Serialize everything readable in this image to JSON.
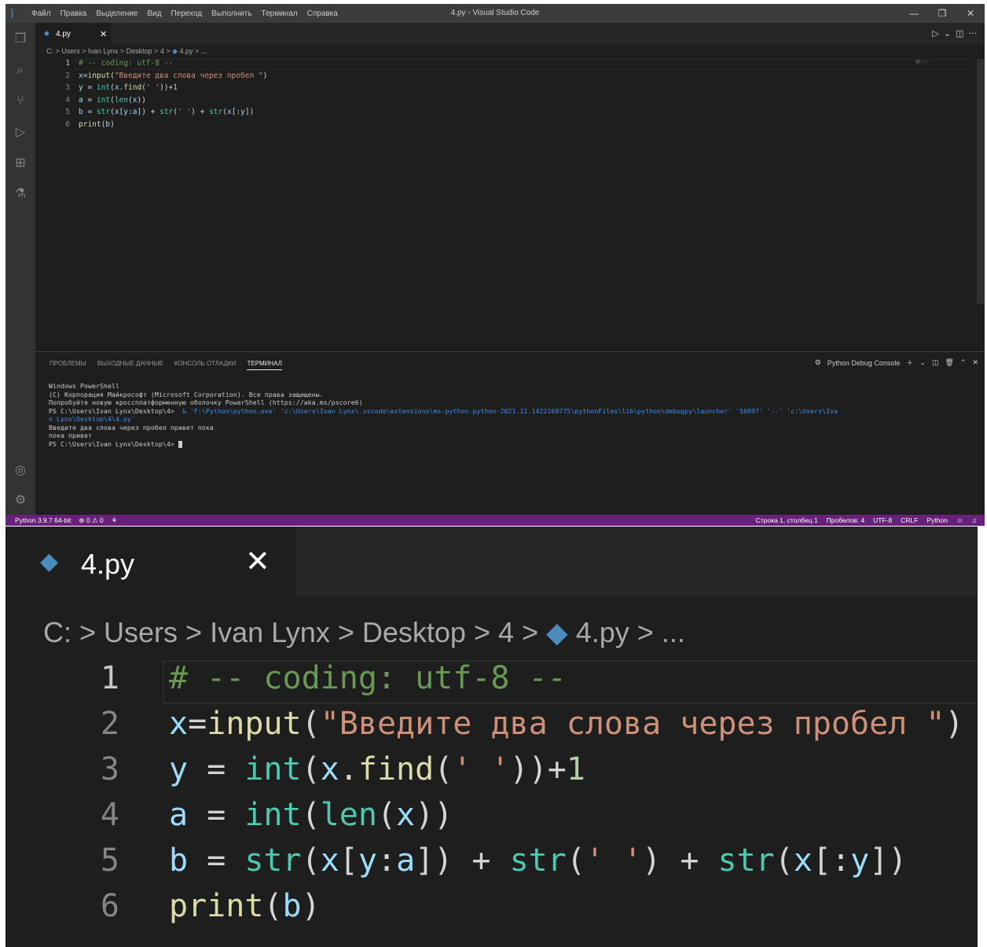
{
  "window": {
    "menu": [
      "Файл",
      "Правка",
      "Выделение",
      "Вид",
      "Переход",
      "Выполнить",
      "Терминал",
      "Справка"
    ],
    "title": "4.py - Visual Studio Code",
    "controls": [
      "—",
      "❐",
      "✕"
    ]
  },
  "activity_icons": [
    "explorer-icon",
    "search-icon",
    "source-control-icon",
    "run-debug-icon",
    "extensions-icon",
    "testing-icon",
    "account-icon",
    "settings-gear-icon"
  ],
  "editor": {
    "tab": {
      "name": "4.py",
      "close": "✕"
    },
    "tab_actions": [
      "▷",
      "⌄",
      "◫",
      "···"
    ],
    "breadcrumb": [
      "C:",
      "Users",
      "Ivan Lynx",
      "Desktop",
      "4",
      "4.py",
      "..."
    ],
    "lines": [
      {
        "n": "1",
        "text": "# -- coding: utf-8 --"
      },
      {
        "n": "2",
        "text": "x=input(\"Введите два слова через пробел \")"
      },
      {
        "n": "3",
        "text": "y = int(x.find(' '))+1"
      },
      {
        "n": "4",
        "text": "a = int(len(x))"
      },
      {
        "n": "5",
        "text": "b = str(x[y:a]) + str(' ') + str(x[:y])"
      },
      {
        "n": "6",
        "text": "print(b)"
      }
    ]
  },
  "panel": {
    "tabs": [
      "ПРОБЛЕМЫ",
      "ВЫХОДНЫЕ ДАННЫЕ",
      "КОНСОЛЬ ОТЛАДКИ",
      "ТЕРМИНАЛ"
    ],
    "active_tab": "ТЕРМИНАЛ",
    "terminal_name": "Python Debug Console",
    "terminal_lines": [
      "Windows PowerShell",
      "(C) Корпорация Майкрософт (Microsoft Corporation). Все права защищены.",
      "",
      "Попробуйте новую кроссплатформенную оболочку PowerShell (https://aka.ms/pscore6)",
      "",
      "PS C:\\Users\\Ivan Lynx\\Desktop\\4>",
      "n Lynx\\Desktop\\4\\4.py'",
      "Введите два слова через пробел привет пока",
      "пока привет",
      "PS C:\\Users\\Ivan Lynx\\Desktop\\4>"
    ],
    "command": "& 'F:\\Python\\python.exe' 'c:\\Users\\Ivan Lynx\\.vscode\\extensions\\ms-python.python-2021.11.1422169775\\pythonFiles\\lib\\python\\debugpy\\launcher' '50097' '--' 'c:\\Users\\Iva"
  },
  "statusbar": {
    "interpreter": "Python 3.9.7 64-bit",
    "errors": "⊗ 0",
    "warnings": "⚠ 0",
    "position": "Строка 1, столбец 1",
    "spaces": "Пробелов: 4",
    "encoding": "UTF-8",
    "eol": "CRLF",
    "language": "Python"
  },
  "colors": {
    "statusbar": "#68217a",
    "editor_bg": "#1e1e1e",
    "comment": "#6a9955",
    "string": "#ce9178",
    "builtin": "#4ec9b0",
    "variable": "#9cdcfe",
    "function": "#dcdcaa"
  }
}
